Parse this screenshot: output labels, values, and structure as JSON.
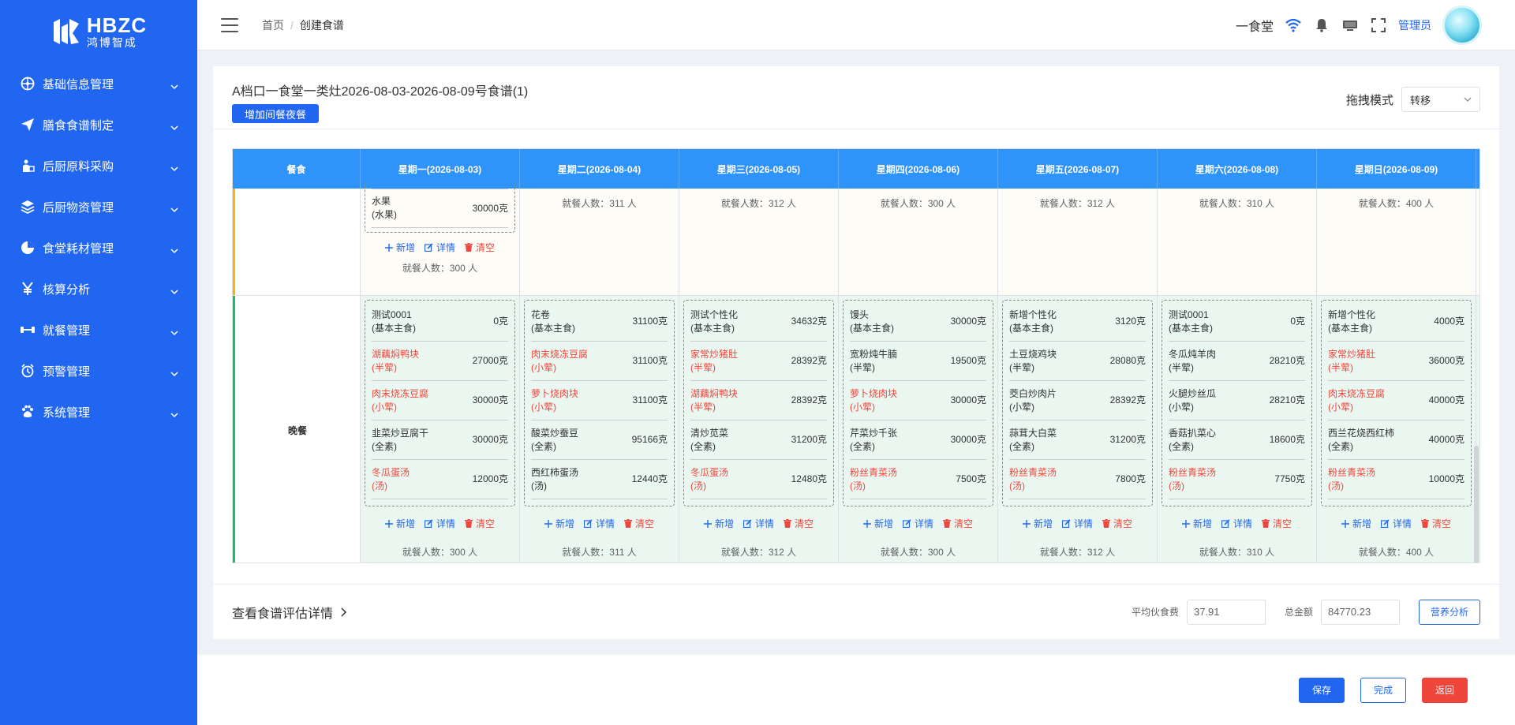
{
  "brand": {
    "name_en": "HBZC",
    "name_cn": "鸿博智成"
  },
  "sidebar": {
    "items": [
      {
        "label": "基础信息管理",
        "icon": "gear-wheel-icon"
      },
      {
        "label": "膳食食谱制定",
        "icon": "paper-plane-icon"
      },
      {
        "label": "后厨原料采购",
        "icon": "shopping-person-icon"
      },
      {
        "label": "后厨物资管理",
        "icon": "layers-icon"
      },
      {
        "label": "食堂耗材管理",
        "icon": "pie-icon"
      },
      {
        "label": "核算分析",
        "icon": "yen-icon"
      },
      {
        "label": "就餐管理",
        "icon": "dumbbell-icon"
      },
      {
        "label": "预警管理",
        "icon": "alarm-icon"
      },
      {
        "label": "系统管理",
        "icon": "paw-icon"
      }
    ]
  },
  "header": {
    "breadcrumb": [
      "首页",
      "创建食谱"
    ],
    "canteen": "一食堂",
    "admin": "管理员"
  },
  "page": {
    "title": "A档口一食堂一类灶2026-08-03-2026-08-09号食谱(1)",
    "add_button": "增加间餐夜餐",
    "drag_label": "拖拽模式",
    "drag_value": "转移"
  },
  "table": {
    "meal_header": "餐食",
    "days": [
      "星期一(2026-08-03)",
      "星期二(2026-08-04)",
      "星期三(2026-08-05)",
      "星期四(2026-08-06)",
      "星期五(2026-08-07)",
      "星期六(2026-08-08)",
      "星期日(2026-08-09)"
    ],
    "upper_row": {
      "monday_fruit": {
        "name": "水果",
        "type": "(水果)",
        "qty": "30000克"
      },
      "monday_diners": "就餐人数：300 人",
      "other_diners": [
        "就餐人数：311 人",
        "就餐人数：312 人",
        "就餐人数：300 人",
        "就餐人数：312 人",
        "就餐人数：310 人",
        "就餐人数：400 人"
      ]
    },
    "dinner": {
      "meal_label": "晚餐",
      "days": [
        {
          "dishes": [
            {
              "name": "测试0001",
              "type": "(基本主食)",
              "qty": "0克",
              "red": false
            },
            {
              "name": "湖藕焖鸭块",
              "type": "(半荤)",
              "qty": "27000克",
              "red": true
            },
            {
              "name": "肉末烧冻豆腐",
              "type": "(小荤)",
              "qty": "30000克",
              "red": true
            },
            {
              "name": "韭菜炒豆腐干",
              "type": "(全素)",
              "qty": "30000克",
              "red": false
            },
            {
              "name": "冬瓜蛋汤",
              "type": "(汤)",
              "qty": "12000克",
              "red": true
            }
          ],
          "diners": "就餐人数：300 人"
        },
        {
          "dishes": [
            {
              "name": "花卷",
              "type": "(基本主食)",
              "qty": "31100克",
              "red": false
            },
            {
              "name": "肉末烧冻豆腐",
              "type": "(小荤)",
              "qty": "31100克",
              "red": true
            },
            {
              "name": "萝卜烧肉块",
              "type": "(小荤)",
              "qty": "31100克",
              "red": true
            },
            {
              "name": "酸菜炒蚕豆",
              "type": "(全素)",
              "qty": "95166克",
              "red": false
            },
            {
              "name": "西红柿蛋汤",
              "type": "(汤)",
              "qty": "12440克",
              "red": false
            }
          ],
          "diners": "就餐人数：311 人"
        },
        {
          "dishes": [
            {
              "name": "测试个性化",
              "type": "(基本主食)",
              "qty": "34632克",
              "red": false
            },
            {
              "name": "家常炒猪肚",
              "type": "(半荤)",
              "qty": "28392克",
              "red": true
            },
            {
              "name": "湖藕焖鸭块",
              "type": "(半荤)",
              "qty": "28392克",
              "red": true
            },
            {
              "name": "清炒苋菜",
              "type": "(全素)",
              "qty": "31200克",
              "red": false
            },
            {
              "name": "冬瓜蛋汤",
              "type": "(汤)",
              "qty": "12480克",
              "red": true
            }
          ],
          "diners": "就餐人数：312 人"
        },
        {
          "dishes": [
            {
              "name": "馒头",
              "type": "(基本主食)",
              "qty": "30000克",
              "red": false
            },
            {
              "name": "宽粉炖牛腩",
              "type": "(半荤)",
              "qty": "19500克",
              "red": false
            },
            {
              "name": "萝卜烧肉块",
              "type": "(小荤)",
              "qty": "30000克",
              "red": true
            },
            {
              "name": "芹菜炒千张",
              "type": "(全素)",
              "qty": "30000克",
              "red": false
            },
            {
              "name": "粉丝青菜汤",
              "type": "(汤)",
              "qty": "7500克",
              "red": true
            }
          ],
          "diners": "就餐人数：300 人"
        },
        {
          "dishes": [
            {
              "name": "新增个性化",
              "type": "(基本主食)",
              "qty": "3120克",
              "red": false
            },
            {
              "name": "土豆烧鸡块",
              "type": "(半荤)",
              "qty": "28080克",
              "red": false
            },
            {
              "name": "茭白炒肉片",
              "type": "(小荤)",
              "qty": "28392克",
              "red": false
            },
            {
              "name": "蒜茸大白菜",
              "type": "(全素)",
              "qty": "31200克",
              "red": false
            },
            {
              "name": "粉丝青菜汤",
              "type": "(汤)",
              "qty": "7800克",
              "red": true
            }
          ],
          "diners": "就餐人数：312 人"
        },
        {
          "dishes": [
            {
              "name": "测试0001",
              "type": "(基本主食)",
              "qty": "0克",
              "red": false
            },
            {
              "name": "冬瓜炖羊肉",
              "type": "(半荤)",
              "qty": "28210克",
              "red": false
            },
            {
              "name": "火腿炒丝瓜",
              "type": "(小荤)",
              "qty": "28210克",
              "red": false
            },
            {
              "name": "香菇扒菜心",
              "type": "(全素)",
              "qty": "18600克",
              "red": false
            },
            {
              "name": "粉丝青菜汤",
              "type": "(汤)",
              "qty": "7750克",
              "red": true
            }
          ],
          "diners": "就餐人数：310 人"
        },
        {
          "dishes": [
            {
              "name": "新增个性化",
              "type": "(基本主食)",
              "qty": "4000克",
              "red": false
            },
            {
              "name": "家常炒猪肚",
              "type": "(半荤)",
              "qty": "36000克",
              "red": true
            },
            {
              "name": "肉末烧冻豆腐",
              "type": "(小荤)",
              "qty": "40000克",
              "red": true
            },
            {
              "name": "西兰花烧西红柿",
              "type": "(全素)",
              "qty": "40000克",
              "red": false
            },
            {
              "name": "粉丝青菜汤",
              "type": "(汤)",
              "qty": "10000克",
              "red": true
            }
          ],
          "diners": "就餐人数：400 人"
        }
      ]
    },
    "actions": {
      "add": "新增",
      "detail": "详情",
      "clear": "清空"
    }
  },
  "footer": {
    "eval_link": "查看食谱评估详情",
    "avg_label": "平均伙食费",
    "avg_value": "37.91",
    "total_label": "总金额",
    "total_value": "84770.23",
    "nutri_button": "营养分析"
  },
  "bottom": {
    "save": "保存",
    "done": "完成",
    "back": "返回"
  },
  "colors": {
    "primary": "#2166f0",
    "header_blue": "#2e93fb",
    "red": "#f0453a",
    "dinner_bg": "#eaf7f1",
    "upper_bg": "#fefcf6"
  }
}
